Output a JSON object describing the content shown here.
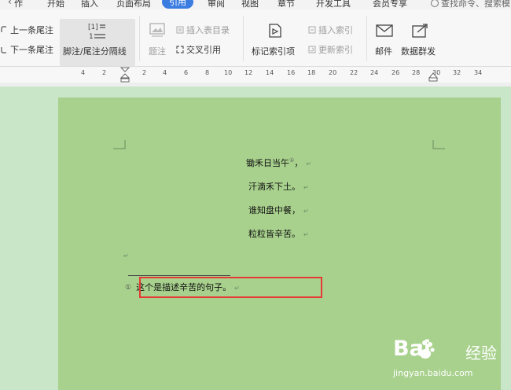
{
  "menu": {
    "items": [
      "作",
      "开始",
      "插入",
      "页面布局",
      "审阅",
      "视图",
      "章节",
      "开发工具",
      "会员专享"
    ],
    "active": "引用",
    "search_placeholder": "查找命令、搜索模"
  },
  "ribbon": {
    "prev_footnote": "上一条尾注",
    "next_footnote": "下一条尾注",
    "separator_label": "脚注/尾注分隔线",
    "caption": "题注",
    "insert_toc": "插入表目录",
    "cross_ref": "交叉引用",
    "mark_index": "标记索引项",
    "insert_index": "插入索引",
    "update_index": "更新索引",
    "mail": "邮件",
    "mail_merge": "数据群发"
  },
  "ruler": {
    "ticks": [
      "4",
      "2",
      "2",
      "4",
      "6",
      "8",
      "10",
      "12",
      "14",
      "16",
      "18",
      "20",
      "22",
      "24",
      "26",
      "28",
      "30",
      "32",
      "34"
    ]
  },
  "document": {
    "line1": "锄禾日当午",
    "ref_mark": "①",
    "line1_end": "，",
    "line2": "汗滴禾下土。",
    "line3": "谁知盘中餐，",
    "line4": "粒粒皆辛苦。",
    "para_mark": "↵",
    "footnote_mark": "①",
    "footnote_text": "这个是描述辛苦的句子。"
  },
  "watermark": {
    "logo": "Bai",
    "logo2": "经验",
    "url": "jingyan.baidu.com"
  }
}
